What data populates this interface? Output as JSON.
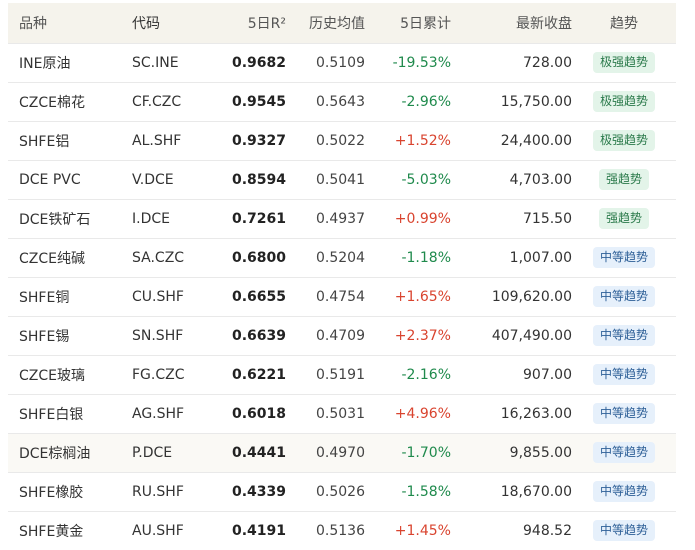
{
  "headers": {
    "name": "品种",
    "code": "代码",
    "r2": "5日R²",
    "avg": "历史均值",
    "cum": "5日累计",
    "close": "最新收盘",
    "trend": "趋势"
  },
  "colors": {
    "positive": "#d9442f",
    "negative": "#1f8a4c",
    "badge_strong_bg": "#e3f4e9",
    "badge_mid_bg": "#e6f0fb"
  },
  "rows": [
    {
      "name": "INE原油",
      "code": "SC.INE",
      "r2": "0.9682",
      "avg": "0.5109",
      "cum": "-19.53%",
      "close": "728.00",
      "trend": "极强趋势",
      "dir": "neg",
      "level": "strong"
    },
    {
      "name": "CZCE棉花",
      "code": "CF.CZC",
      "r2": "0.9545",
      "avg": "0.5643",
      "cum": "-2.96%",
      "close": "15,750.00",
      "trend": "极强趋势",
      "dir": "neg",
      "level": "strong"
    },
    {
      "name": "SHFE铝",
      "code": "AL.SHF",
      "r2": "0.9327",
      "avg": "0.5022",
      "cum": "+1.52%",
      "close": "24,400.00",
      "trend": "极强趋势",
      "dir": "pos",
      "level": "strong"
    },
    {
      "name": "DCE PVC",
      "code": "V.DCE",
      "r2": "0.8594",
      "avg": "0.5041",
      "cum": "-5.03%",
      "close": "4,703.00",
      "trend": "强趋势",
      "dir": "neg",
      "level": "strong"
    },
    {
      "name": "DCE铁矿石",
      "code": "I.DCE",
      "r2": "0.7261",
      "avg": "0.4937",
      "cum": "+0.99%",
      "close": "715.50",
      "trend": "强趋势",
      "dir": "pos",
      "level": "strong"
    },
    {
      "name": "CZCE纯碱",
      "code": "SA.CZC",
      "r2": "0.6800",
      "avg": "0.5204",
      "cum": "-1.18%",
      "close": "1,007.00",
      "trend": "中等趋势",
      "dir": "neg",
      "level": "mid"
    },
    {
      "name": "SHFE铜",
      "code": "CU.SHF",
      "r2": "0.6655",
      "avg": "0.4754",
      "cum": "+1.65%",
      "close": "109,620.00",
      "trend": "中等趋势",
      "dir": "pos",
      "level": "mid"
    },
    {
      "name": "SHFE锡",
      "code": "SN.SHF",
      "r2": "0.6639",
      "avg": "0.4709",
      "cum": "+2.37%",
      "close": "407,490.00",
      "trend": "中等趋势",
      "dir": "pos",
      "level": "mid"
    },
    {
      "name": "CZCE玻璃",
      "code": "FG.CZC",
      "r2": "0.6221",
      "avg": "0.5191",
      "cum": "-2.16%",
      "close": "907.00",
      "trend": "中等趋势",
      "dir": "neg",
      "level": "mid"
    },
    {
      "name": "SHFE白银",
      "code": "AG.SHF",
      "r2": "0.6018",
      "avg": "0.5031",
      "cum": "+4.96%",
      "close": "16,263.00",
      "trend": "中等趋势",
      "dir": "pos",
      "level": "mid"
    },
    {
      "name": "DCE棕榈油",
      "code": "P.DCE",
      "r2": "0.4441",
      "avg": "0.4970",
      "cum": "-1.70%",
      "close": "9,855.00",
      "trend": "中等趋势",
      "dir": "neg",
      "level": "mid",
      "highlight": true
    },
    {
      "name": "SHFE橡胶",
      "code": "RU.SHF",
      "r2": "0.4339",
      "avg": "0.5026",
      "cum": "-1.58%",
      "close": "18,670.00",
      "trend": "中等趋势",
      "dir": "neg",
      "level": "mid"
    },
    {
      "name": "SHFE黄金",
      "code": "AU.SHF",
      "r2": "0.4191",
      "avg": "0.5136",
      "cum": "+1.45%",
      "close": "948.52",
      "trend": "中等趋势",
      "dir": "pos",
      "level": "mid"
    }
  ]
}
